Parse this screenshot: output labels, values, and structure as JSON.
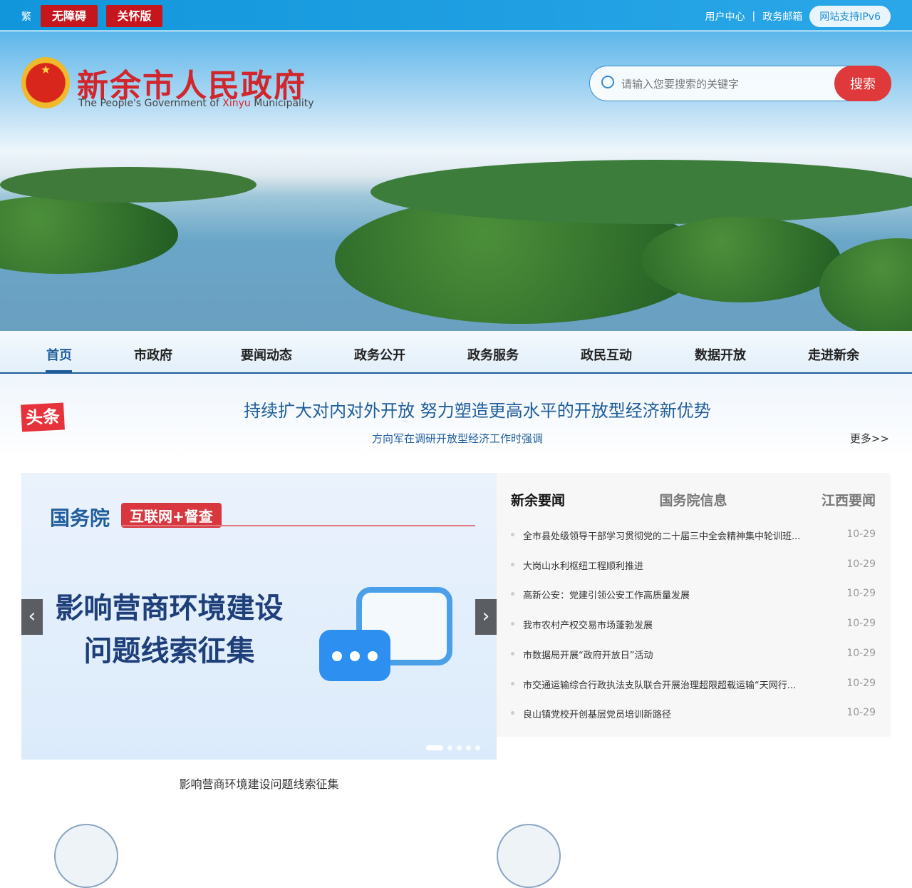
{
  "topbar": {
    "traditional": "繁",
    "accessibility": "无障碍",
    "care_mode": "关怀版",
    "user_center": "用户中心",
    "separator": "|",
    "gov_mail": "政务邮箱",
    "ipv6": "网站支持IPv6"
  },
  "header": {
    "title": "新余市人民政府",
    "subtitle_pre": "The People's Government of ",
    "subtitle_city": "Xinyu",
    "subtitle_post": " Municipality",
    "search_placeholder": "请输入您要搜索的关键字",
    "search_button": "搜索"
  },
  "nav": [
    "首页",
    "市政府",
    "要闻动态",
    "政务公开",
    "政务服务",
    "政民互动",
    "数据开放",
    "走进新余"
  ],
  "headline": {
    "tag": "头条",
    "title": "持续扩大对内对外开放 努力塑造更高水平的开放型经济新优势",
    "subtitle": "方向军在调研开放型经济工作时强调",
    "more": "更多>>"
  },
  "slider": {
    "banner_org": "国务院",
    "banner_tag": "互联网+督查",
    "banner_line1": "影响营商环境建设",
    "banner_line2": "问题线索征集",
    "caption": "影响营商环境建设问题线索征集",
    "prev": "‹",
    "next": "›",
    "slide_count": 5,
    "active_slide": 1
  },
  "news": {
    "tabs": [
      "新余要闻",
      "国务院信息",
      "江西要闻"
    ],
    "active_tab": 0,
    "items": [
      {
        "title": "全市县处级领导干部学习贯彻党的二十届三中全会精神集中轮训班...",
        "date": "10-29"
      },
      {
        "title": "大岗山水利枢纽工程顺利推进",
        "date": "10-29"
      },
      {
        "title": "高新公安：党建引领公安工作高质量发展",
        "date": "10-29"
      },
      {
        "title": "我市农村产权交易市场蓬勃发展",
        "date": "10-29"
      },
      {
        "title": "市数据局开展“政府开放日”活动",
        "date": "10-29"
      },
      {
        "title": "市交通运输综合行政执法支队联合开展治理超限超载运输“天网行...",
        "date": "10-29"
      },
      {
        "title": "良山镇党校开创基层党员培训新路径",
        "date": "10-29"
      }
    ]
  }
}
